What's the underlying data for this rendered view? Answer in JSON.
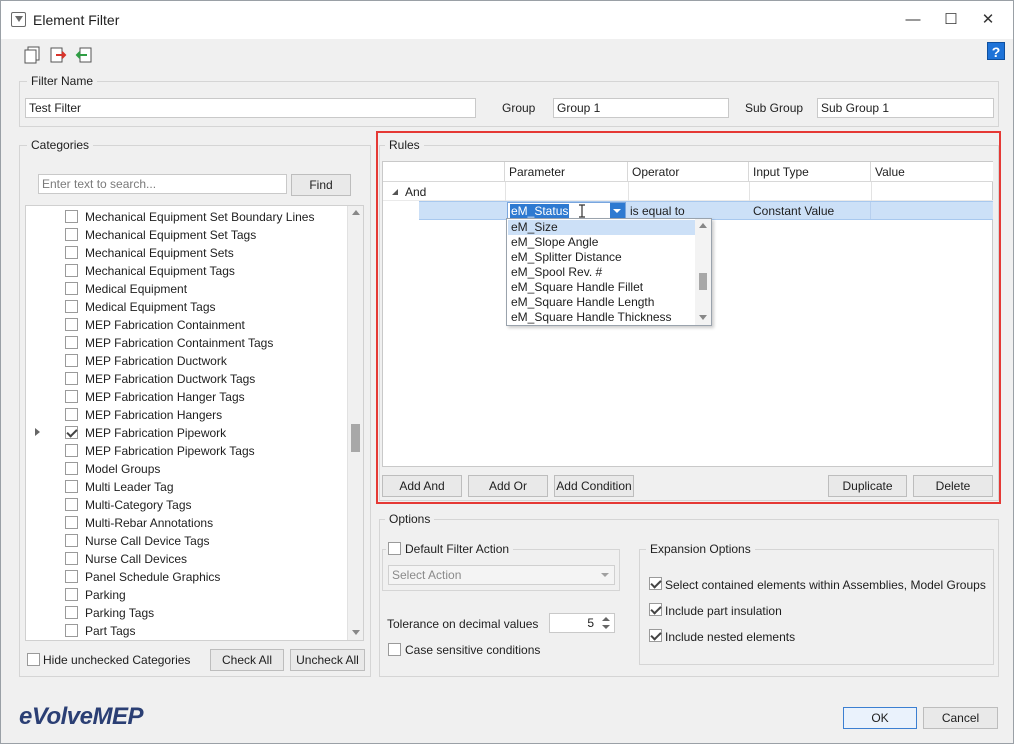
{
  "window": {
    "title": "Element Filter",
    "minimize": "—",
    "maximize": "☐",
    "close": "✕",
    "help": "?"
  },
  "filter_name": {
    "legend": "Filter Name",
    "name_value": "Test Filter",
    "group_label": "Group",
    "group_value": "Group 1",
    "subgroup_label": "Sub Group",
    "subgroup_value": "Sub Group 1"
  },
  "categories": {
    "legend": "Categories",
    "search_placeholder": "Enter text to search...",
    "find_label": "Find",
    "items": [
      {
        "label": "Mechanical Equipment Set Boundary Lines",
        "checked": false
      },
      {
        "label": "Mechanical Equipment Set Tags",
        "checked": false
      },
      {
        "label": "Mechanical Equipment Sets",
        "checked": false
      },
      {
        "label": "Mechanical Equipment Tags",
        "checked": false
      },
      {
        "label": "Medical Equipment",
        "checked": false
      },
      {
        "label": "Medical Equipment Tags",
        "checked": false
      },
      {
        "label": "MEP Fabrication Containment",
        "checked": false
      },
      {
        "label": "MEP Fabrication Containment Tags",
        "checked": false
      },
      {
        "label": "MEP Fabrication Ductwork",
        "checked": false
      },
      {
        "label": "MEP Fabrication Ductwork Tags",
        "checked": false
      },
      {
        "label": "MEP Fabrication Hanger Tags",
        "checked": false
      },
      {
        "label": "MEP Fabrication Hangers",
        "checked": false
      },
      {
        "label": "MEP Fabrication Pipework",
        "checked": true
      },
      {
        "label": "MEP Fabrication Pipework Tags",
        "checked": false
      },
      {
        "label": "Model Groups",
        "checked": false
      },
      {
        "label": "Multi Leader Tag",
        "checked": false
      },
      {
        "label": "Multi-Category Tags",
        "checked": false
      },
      {
        "label": "Multi-Rebar Annotations",
        "checked": false
      },
      {
        "label": "Nurse Call Device Tags",
        "checked": false
      },
      {
        "label": "Nurse Call Devices",
        "checked": false
      },
      {
        "label": "Panel Schedule Graphics",
        "checked": false
      },
      {
        "label": "Parking",
        "checked": false
      },
      {
        "label": "Parking Tags",
        "checked": false
      },
      {
        "label": "Part Tags",
        "checked": false
      }
    ],
    "hide_unchecked_label": "Hide unchecked Categories",
    "check_all_label": "Check All",
    "uncheck_all_label": "Uncheck All"
  },
  "rules": {
    "legend": "Rules",
    "columns": [
      "Parameter",
      "Operator",
      "Input Type",
      "Value"
    ],
    "group_operator": "And",
    "condition": {
      "parameter": "eM_Status",
      "operator": "is equal to",
      "input_type": "Constant Value",
      "value": ""
    },
    "dropdown_items": [
      "eM_Size",
      "eM_Slope Angle",
      "eM_Splitter Distance",
      "eM_Spool Rev. #",
      "eM_Square Handle Fillet",
      "eM_Square Handle Length",
      "eM_Square Handle Thickness"
    ],
    "add_and_label": "Add And",
    "add_or_label": "Add Or",
    "add_condition_label": "Add Condition",
    "duplicate_label": "Duplicate",
    "delete_label": "Delete"
  },
  "options": {
    "legend": "Options",
    "default_filter_action_label": "Default Filter Action",
    "select_action_placeholder": "Select Action",
    "tolerance_label": "Tolerance on decimal values",
    "tolerance_value": "5",
    "case_sensitive_label": "Case sensitive conditions",
    "expansion_legend": "Expansion Options",
    "expansion_items": [
      {
        "label": "Select contained elements within Assemblies, Model Groups",
        "checked": true
      },
      {
        "label": "Include part insulation",
        "checked": true
      },
      {
        "label": "Include nested elements",
        "checked": true
      }
    ]
  },
  "footer": {
    "logo_text": "eVolveMEP",
    "ok_label": "OK",
    "cancel_label": "Cancel"
  },
  "colors": {
    "accent": "#2e7ad1",
    "highlight_frame": "#e53935",
    "selection": "#cce0f7"
  }
}
